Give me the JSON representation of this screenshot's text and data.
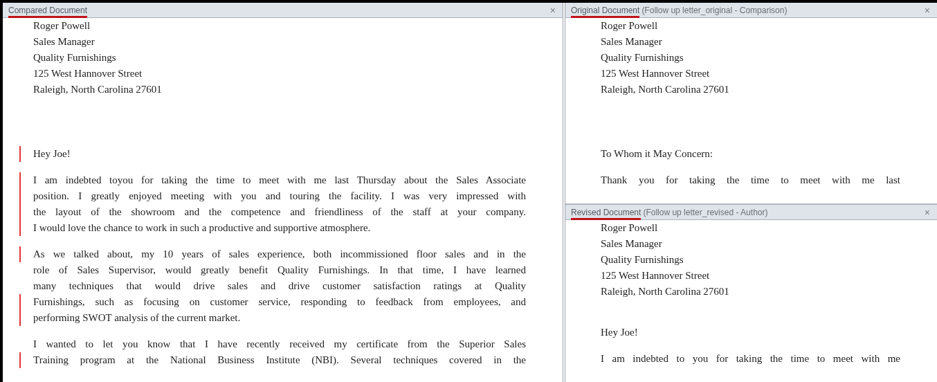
{
  "compared": {
    "title": "Compared Document",
    "close": "×",
    "address": [
      "Roger Powell",
      "Sales Manager",
      "Quality Furnishings",
      "125 West Hannover Street",
      "Raleigh, North Carolina 27601"
    ],
    "paragraphs": [
      {
        "lines": [
          {
            "text": "Hey Joe!",
            "changed": true
          }
        ]
      },
      {
        "lines": [
          {
            "text": "I am indebted toyou for taking the time to meet with me last Thursday about the Sales Associate",
            "changed": true
          },
          {
            "text": "position. I greatly enjoyed meeting with you and touring the facility. I was very impressed with",
            "changed": true
          },
          {
            "text": "the layout of the showroom and the competence and friendliness of the staff at your company.",
            "changed": true
          },
          {
            "text": "I would love the chance to work in such a productive and supportive atmosphere.",
            "changed": true
          }
        ]
      },
      {
        "lines": [
          {
            "text": "As we talked about, my 10 years of sales experience, both incommissioned floor sales and in the",
            "changed": true
          },
          {
            "text": "role of Sales Supervisor, would greatly benefit Quality Furnishings. In that time, I have learned",
            "changed": false
          },
          {
            "text": "many techniques that would drive sales and drive customer satisfaction ratings at Quality",
            "changed": false
          },
          {
            "text": "Furnishings, such as focusing on customer service, responding to feedback from employees, and",
            "changed": true
          },
          {
            "text": "performing SWOT analysis of the current market.",
            "changed": true
          }
        ]
      },
      {
        "cut": true,
        "lines": [
          {
            "text": "I wanted to let you know that I have recently received my certificate from the Superior Sales",
            "changed": false
          },
          {
            "text": "Training program at the National Business Institute (NBI). Several techniques covered in the",
            "changed": true
          }
        ]
      }
    ]
  },
  "original": {
    "title": "Original Document",
    "subtitle": "(Follow up letter_original - Comparison)",
    "close": "×",
    "address": [
      "Roger Powell",
      "Sales Manager",
      "Quality Furnishings",
      "125 West Hannover Street",
      "Raleigh, North Carolina 27601"
    ],
    "paragraphs": [
      {
        "lines": [
          {
            "text": "To Whom it May Concern:"
          }
        ]
      },
      {
        "cut": true,
        "lines": [
          {
            "text": "Thank you for taking the time to meet with me last"
          }
        ]
      }
    ]
  },
  "revised": {
    "title": "Revised Document",
    "subtitle": "(Follow up letter_revised - Author)",
    "close": "×",
    "address": [
      "Roger Powell",
      "Sales Manager",
      "Quality Furnishings",
      "125 West Hannover Street",
      "Raleigh, North Carolina 27601"
    ],
    "paragraphs": [
      {
        "lines": [
          {
            "text": "Hey Joe!"
          }
        ]
      },
      {
        "cut": true,
        "lines": [
          {
            "text": "I am indebted to you for taking the time to meet with me"
          }
        ]
      }
    ]
  }
}
